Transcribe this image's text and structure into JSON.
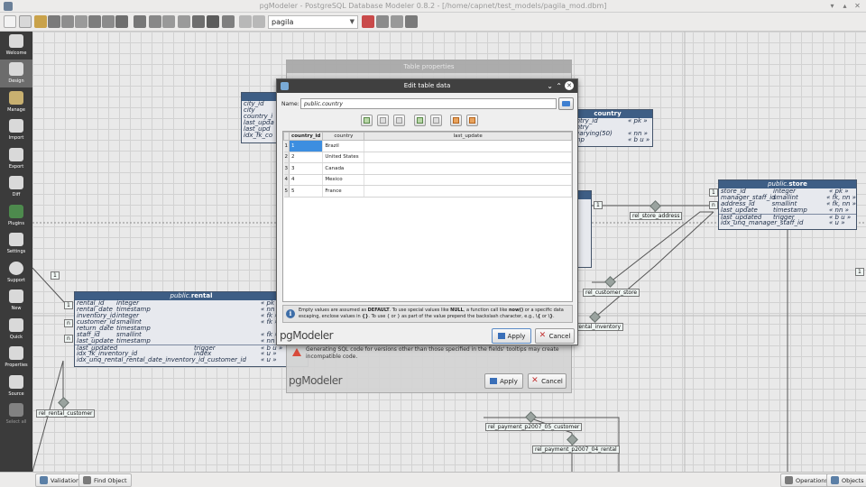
{
  "window": {
    "title": "pgModeler - PostgreSQL Database Modeler 0.8.2 - [/home/capnet/test_models/pagila_mod.dbm]"
  },
  "toolbar": {
    "model_selector": "pagila"
  },
  "sidebar": {
    "items": [
      {
        "label": "Welcome"
      },
      {
        "label": "Design"
      },
      {
        "label": "Manage"
      },
      {
        "label": "Import"
      },
      {
        "label": "Export"
      },
      {
        "label": "Diff"
      },
      {
        "label": "Plugins"
      },
      {
        "label": "Settings"
      },
      {
        "label": "Support"
      },
      {
        "label": "New"
      },
      {
        "label": "Quick"
      },
      {
        "label": "Properties"
      },
      {
        "label": "Source"
      },
      {
        "label": "Select all"
      }
    ]
  },
  "canvas": {
    "tables": {
      "country": {
        "title_schema": "public.",
        "title_name": "country",
        "rows": [
          "country_id",
          "country",
          "ter varying(50)",
          "stamp"
        ],
        "types": [
          "« pk »",
          "",
          "« nn »",
          "« b u »"
        ]
      },
      "city": {
        "rows": [
          "city_id",
          "city",
          "country_i",
          "last_upda",
          "last_upd",
          "idx_fk_co"
        ]
      },
      "store": {
        "title_schema": "public.",
        "title_name": "store",
        "rows": [
          {
            "name": "store_id",
            "type": "integer",
            "constraint": "« pk »"
          },
          {
            "name": "manager_staff_id",
            "type": "smallint",
            "constraint": "« fk, nn »"
          },
          {
            "name": "address_id",
            "type": "smallint",
            "constraint": "« fk, nn »"
          },
          {
            "name": "last_update",
            "type": "timestamp",
            "constraint": "« nn »"
          },
          {
            "name": "last_updated",
            "type": "trigger",
            "constraint": "« b u »"
          },
          {
            "name": "idx_unq_manager_staff_id",
            "type": "index",
            "constraint": "« u »"
          }
        ]
      },
      "rental": {
        "title_schema": "public.",
        "title_name": "rental",
        "rows": [
          {
            "name": "rental_id",
            "type": "integer",
            "constraint": "« pk »"
          },
          {
            "name": "rental_date",
            "type": "timestamp",
            "constraint": "« nn »"
          },
          {
            "name": "inventory_id",
            "type": "integer",
            "constraint": "« fk »"
          },
          {
            "name": "customer_id",
            "type": "smallint",
            "constraint": "« fk »"
          },
          {
            "name": "return_date",
            "type": "timestamp",
            "constraint": ""
          },
          {
            "name": "staff_id",
            "type": "smallint",
            "constraint": "« fk »"
          },
          {
            "name": "last_update",
            "type": "timestamp",
            "constraint": "« nn »"
          },
          {
            "name": "last_updated",
            "type": "trigger",
            "constraint": "« b u »"
          },
          {
            "name": "idx_fk_inventory_id",
            "type": "index",
            "constraint": "« u »"
          },
          {
            "name": "idx_unq_rental_rental_date_inventory_id_customer_id",
            "type": "index",
            "constraint": "« u »"
          }
        ]
      }
    },
    "relations": {
      "rel_store_address": "rel_store_address",
      "rel_customer_store": "rel_customer_store",
      "rental_inventory": "rental_inventory",
      "rel_rental_customer": "rel_rental_customer",
      "rel_payment_customer": "rel_payment_p2007_05_customer",
      "rel_payment_rental": "rel_payment_p2007_04_rental"
    },
    "cardinality": {
      "one": "1",
      "many": "n"
    }
  },
  "bg_dialog": {
    "title": "Table properties",
    "warning": "Generating SQL code for versions other than those specified in the fields' tooltips may create incompatible code.",
    "apply": "Apply",
    "cancel": "Cancel",
    "logo": "pgModeler"
  },
  "dialog": {
    "title": "Edit table data",
    "name_label": "Name:",
    "name_value": "public.country",
    "columns": [
      "country_id",
      "country",
      "last_update"
    ],
    "rows": [
      {
        "n": "1",
        "id": "1",
        "country": "Brazil",
        "last_update": ""
      },
      {
        "n": "2",
        "id": "2",
        "country": "United States",
        "last_update": ""
      },
      {
        "n": "3",
        "id": "3",
        "country": "Canada",
        "last_update": ""
      },
      {
        "n": "4",
        "id": "4",
        "country": "Mexico",
        "last_update": ""
      },
      {
        "n": "5",
        "id": "5",
        "country": "France",
        "last_update": ""
      }
    ],
    "info_1": "Empty values are assumed as ",
    "info_default": "DEFAULT",
    "info_2": ". To use special values like ",
    "info_null": "NULL",
    "info_3": ", a function call like ",
    "info_now": "now()",
    "info_4": " or a specific data escaping, enclose values in ",
    "info_braces": "{}",
    "info_5": ". To use { or } as part of the value prepend the backslash character, e.g., ",
    "info_esc": "\\{",
    "info_6": " or ",
    "info_esc2": "\\}",
    "info_7": ".",
    "apply": "Apply",
    "cancel": "Cancel",
    "logo": "pgModeler"
  },
  "statusbar": {
    "validation": "Validation",
    "find_object": "Find Object",
    "operations": "Operations",
    "objects": "Objects"
  },
  "colors": {
    "table_header": "#3e5e85",
    "selection": "#3d8ee0",
    "sidebar": "#3b3b3b"
  }
}
